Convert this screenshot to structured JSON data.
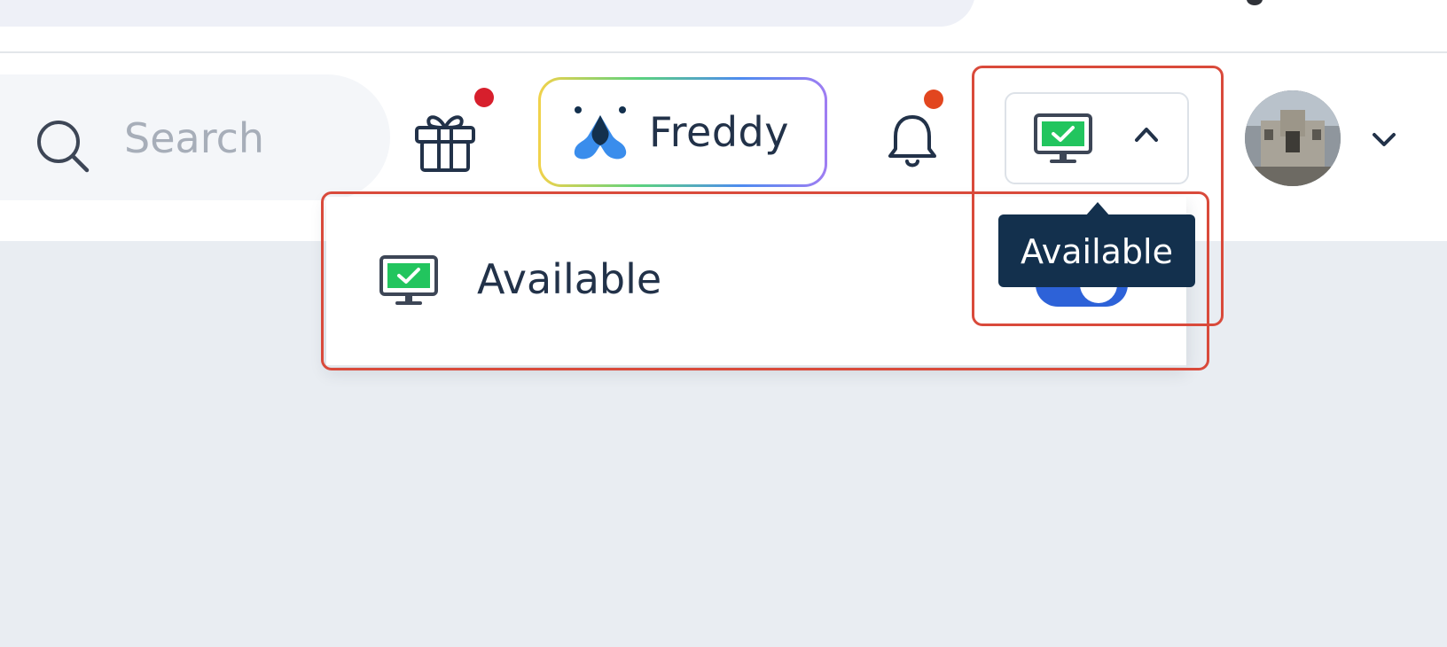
{
  "header": {
    "search": {
      "placeholder": "Search",
      "icon": "search-icon"
    },
    "gift": {
      "icon": "gift-icon",
      "has_notification": true,
      "dot_color": "#d71f2c"
    },
    "freddy": {
      "label": "Freddy",
      "icon": "freddy-logo-icon"
    },
    "notifications": {
      "icon": "bell-icon",
      "has_notification": true,
      "dot_color": "#e2461f"
    },
    "status": {
      "icon": "monitor-available-icon",
      "chevron": "chevron-up-icon",
      "expanded": true
    },
    "profile": {
      "icon": "avatar",
      "chevron": "chevron-down-icon"
    }
  },
  "dropdown": {
    "items": [
      {
        "label": "Available",
        "icon": "monitor-available-icon",
        "toggle_on": true
      }
    ]
  },
  "tooltip": {
    "text": "Available"
  },
  "colors": {
    "accent": "#2d62d8",
    "status_green": "#22c55e",
    "tooltip_bg": "#13304d",
    "annotation": "#d94a3b",
    "text_dark": "#223249"
  }
}
